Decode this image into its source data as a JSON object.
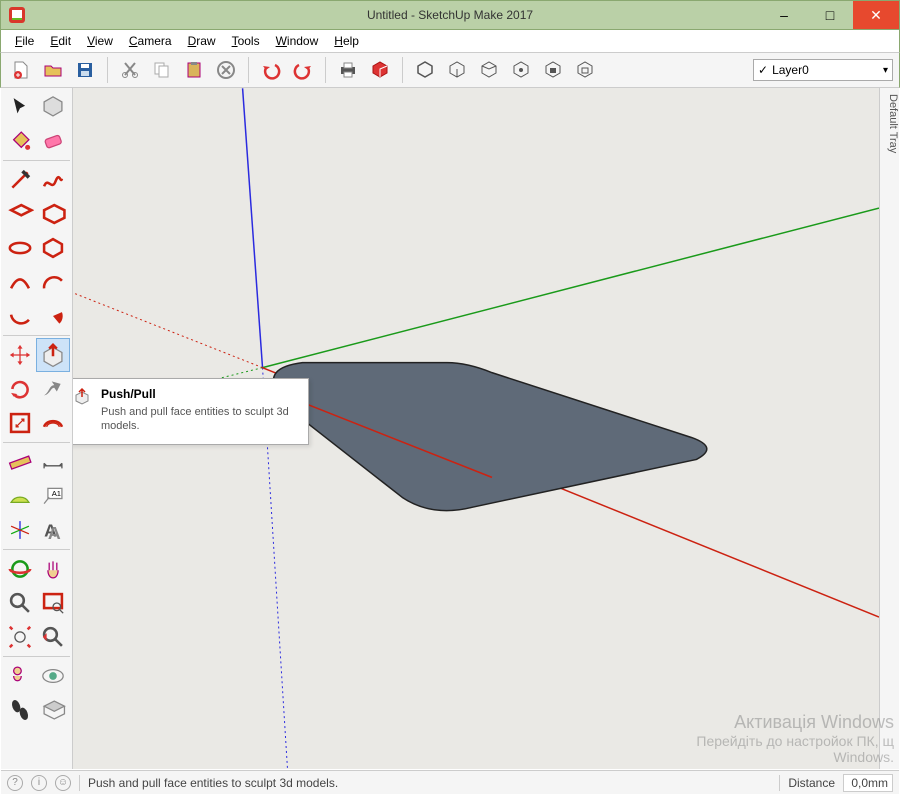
{
  "window": {
    "title": "Untitled - SketchUp Make 2017",
    "min_label": "–",
    "max_label": "□",
    "close_label": "✕"
  },
  "menus": [
    "File",
    "Edit",
    "View",
    "Camera",
    "Draw",
    "Tools",
    "Window",
    "Help"
  ],
  "layer_selector": {
    "selected": "Layer0"
  },
  "tooltip": {
    "title": "Push/Pull",
    "body": "Push and pull face entities to sculpt 3d models."
  },
  "statusbar": {
    "hint": "Push and pull face entities to sculpt 3d models.",
    "distance_label": "Distance",
    "distance_value": "0,0mm"
  },
  "watermark": {
    "line1": "Активація Windows",
    "line2": "Перейдіть до настройок ПК, щ",
    "line3": "Windows."
  },
  "right_tray": {
    "label": "Default Tray"
  },
  "toolbar_icons": [
    "new-file-icon",
    "open-file-icon",
    "save-icon",
    "cut-icon",
    "copy-icon",
    "paste-icon",
    "delete-icon",
    "undo-icon",
    "redo-icon",
    "print-icon",
    "model-info-icon",
    "component-icon",
    "component-hide-icon",
    "component-unhide-icon",
    "component-edit-icon",
    "component-lock-icon",
    "component-unlock-icon"
  ],
  "side_tool_rows": [
    [
      "select-tool-icon",
      "make-component-icon"
    ],
    [
      "paint-bucket-icon",
      "eraser-icon"
    ],
    [
      "-sep-"
    ],
    [
      "line-tool-icon",
      "freehand-icon"
    ],
    [
      "rectangle-icon",
      "rotated-rect-icon"
    ],
    [
      "circle-icon",
      "polygon-icon"
    ],
    [
      "arc-icon",
      "two-point-arc-icon"
    ],
    [
      "three-point-arc-icon",
      "pie-icon"
    ],
    [
      "-sep-"
    ],
    [
      "move-tool-icon",
      "push-pull-icon*"
    ],
    [
      "rotate-icon",
      "follow-me-icon"
    ],
    [
      "scale-icon",
      "offset-icon"
    ],
    [
      "-sep-"
    ],
    [
      "tape-measure-icon",
      "dimension-icon"
    ],
    [
      "protractor-icon",
      "text-label-icon"
    ],
    [
      "axes-icon",
      "3d-text-icon"
    ],
    [
      "-sep-"
    ],
    [
      "orbit-icon",
      "pan-icon"
    ],
    [
      "zoom-icon",
      "zoom-window-icon"
    ],
    [
      "zoom-extents-icon",
      "previous-view-icon"
    ],
    [
      "-sep-"
    ],
    [
      "position-camera-icon",
      "look-around-icon"
    ],
    [
      "walk-icon",
      "section-plane-icon"
    ]
  ]
}
